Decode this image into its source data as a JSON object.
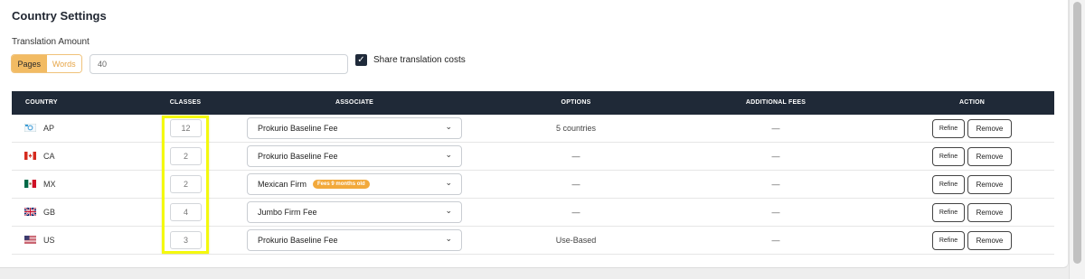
{
  "page": {
    "title": "Country Settings"
  },
  "translation": {
    "label": "Translation Amount",
    "units": [
      "Pages",
      "Words"
    ],
    "selected_unit": "Pages",
    "amount": "40",
    "share_label": "Share translation costs",
    "share_checked": true
  },
  "table": {
    "headers": {
      "country": "COUNTRY",
      "classes": "CLASSES",
      "associate": "ASSOCIATE",
      "options": "OPTIONS",
      "fees": "ADDITIONAL FEES",
      "action": "ACTION"
    },
    "rows": [
      {
        "code": "AP",
        "flag": "ap-flag-icon",
        "classes": "12",
        "associate": "Prokurio Baseline Fee",
        "badge": "",
        "options": "5 countries",
        "fees": "—",
        "refine": "Refine",
        "remove": "Remove"
      },
      {
        "code": "CA",
        "flag": "canada-flag-icon",
        "classes": "2",
        "associate": "Prokurio Baseline Fee",
        "badge": "",
        "options": "—",
        "fees": "—",
        "refine": "Refine",
        "remove": "Remove"
      },
      {
        "code": "MX",
        "flag": "mexico-flag-icon",
        "classes": "2",
        "associate": "Mexican Firm",
        "badge": "Fees 9 months old",
        "options": "—",
        "fees": "—",
        "refine": "Refine",
        "remove": "Remove"
      },
      {
        "code": "GB",
        "flag": "uk-flag-icon",
        "classes": "4",
        "associate": "Jumbo Firm Fee",
        "badge": "",
        "options": "—",
        "fees": "—",
        "refine": "Refine",
        "remove": "Remove"
      },
      {
        "code": "US",
        "flag": "us-flag-icon",
        "classes": "3",
        "associate": "Prokurio Baseline Fee",
        "badge": "",
        "options": "Use-Based",
        "fees": "—",
        "refine": "Refine",
        "remove": "Remove"
      }
    ]
  },
  "colors": {
    "header_bg": "#1f2937",
    "segment_active": "#f2bb63",
    "badge": "#f2a93b",
    "highlight": "#f4f90e"
  }
}
